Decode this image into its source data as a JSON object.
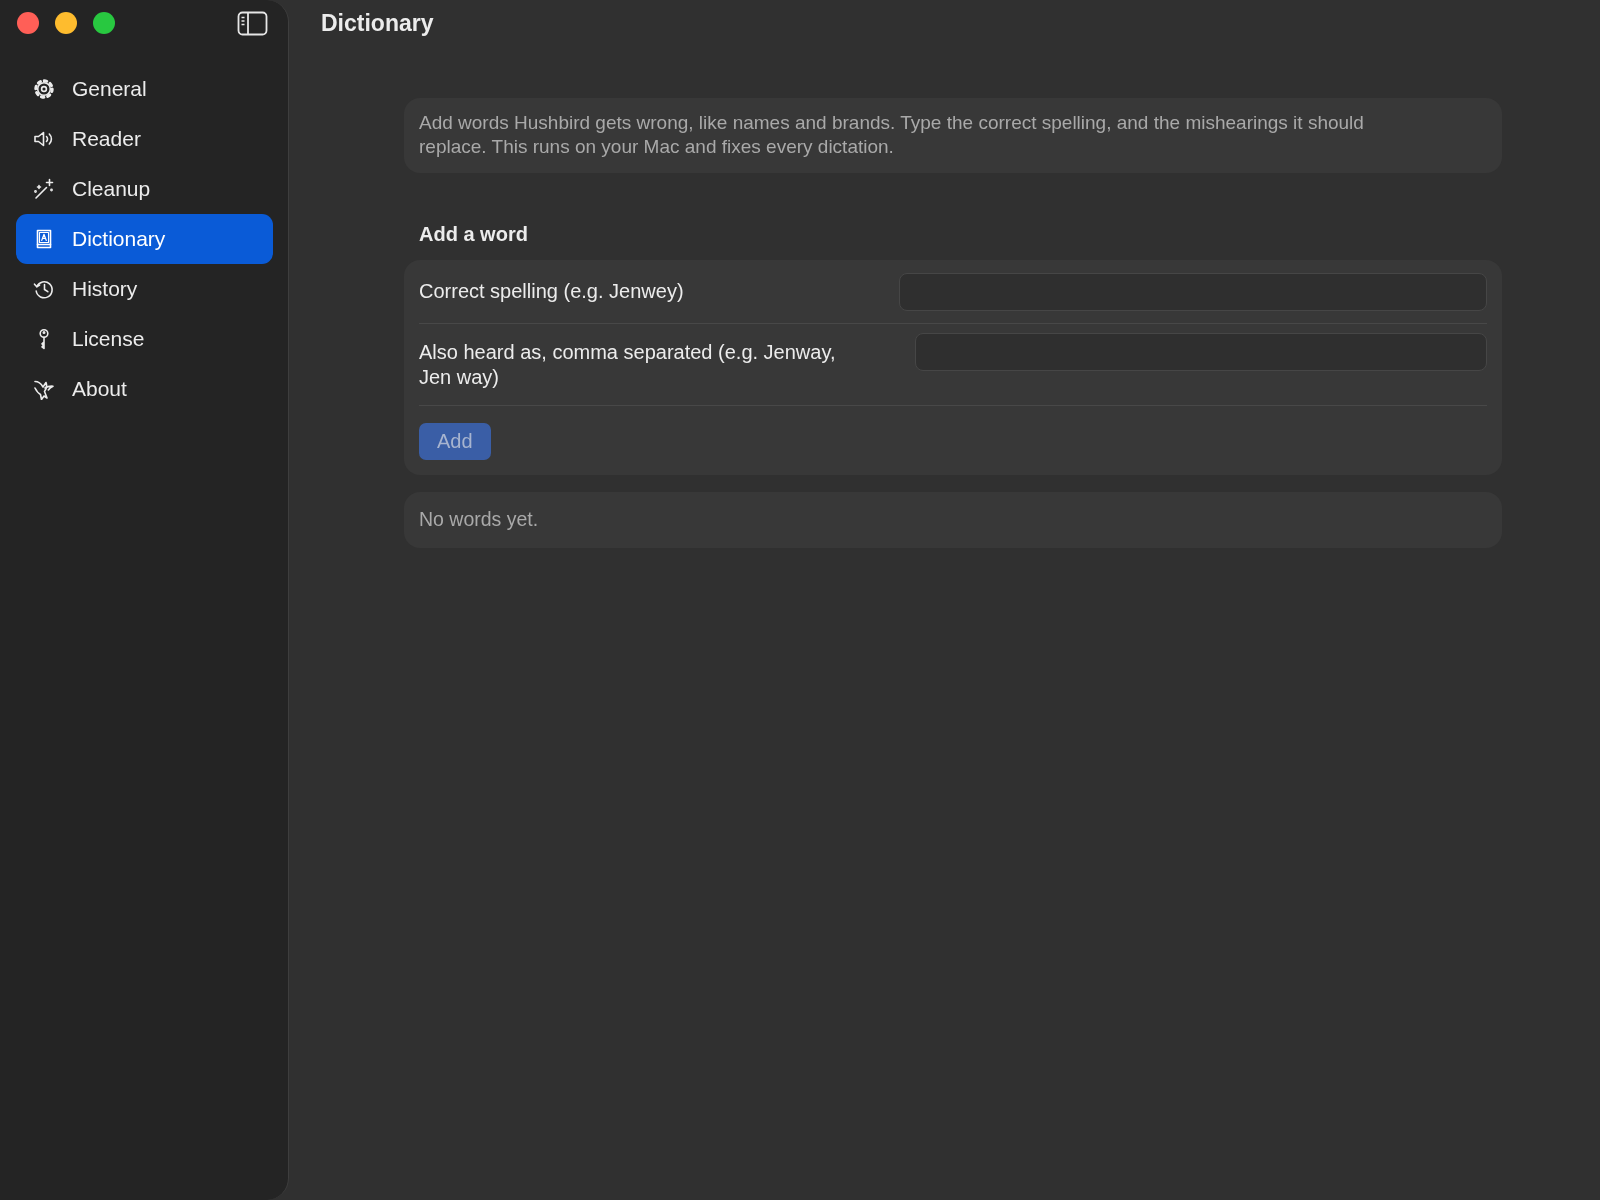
{
  "window": {
    "title": "Dictionary"
  },
  "sidebar": {
    "items": [
      {
        "label": "General",
        "selected": false
      },
      {
        "label": "Reader",
        "selected": false
      },
      {
        "label": "Cleanup",
        "selected": false
      },
      {
        "label": "Dictionary",
        "selected": true
      },
      {
        "label": "History",
        "selected": false
      },
      {
        "label": "License",
        "selected": false
      },
      {
        "label": "About",
        "selected": false
      }
    ]
  },
  "intro": "Add words Hushbird gets wrong, like names and brands. Type the correct spelling, and the mishearings it should replace. This runs on your Mac and fixes every dictation.",
  "add_section": {
    "heading": "Add a word",
    "fields": [
      {
        "label": "Correct spelling (e.g. Jenwey)"
      },
      {
        "label": "Also heard as, comma separated (e.g. Jenway, Jen way)"
      }
    ],
    "button": {
      "label": "Add",
      "disabled": true
    }
  },
  "empty_message": "No words yet."
}
